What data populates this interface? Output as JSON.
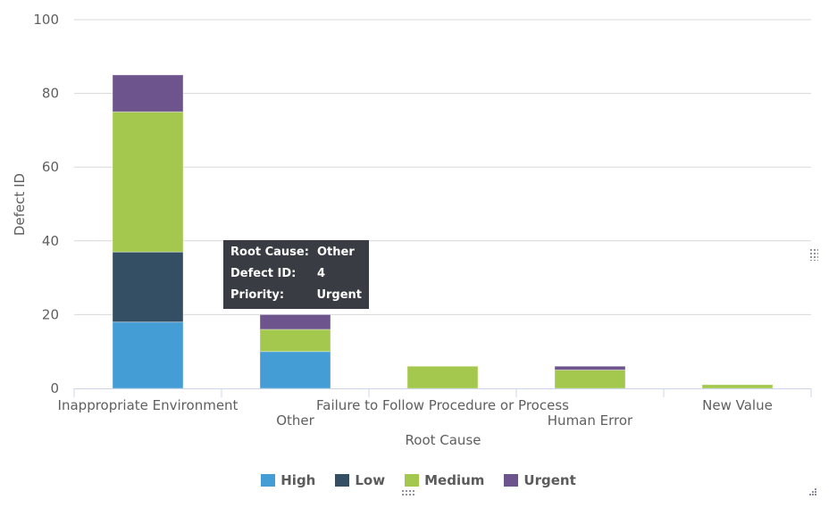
{
  "chart_data": {
    "type": "bar",
    "stacked": true,
    "title": "",
    "xlabel": "Root Cause",
    "ylabel": "Defect ID",
    "ylim": [
      0,
      100
    ],
    "yticks": [
      0,
      20,
      40,
      60,
      80,
      100
    ],
    "grid": true,
    "categories": [
      "Inappropriate Environment",
      "Other",
      "Failure to Follow Procedure or Process",
      "Human Error",
      "New Value"
    ],
    "series": [
      {
        "name": "High",
        "color": "#449dd5",
        "values": [
          18,
          10,
          0,
          0,
          0
        ]
      },
      {
        "name": "Low",
        "color": "#344e64",
        "values": [
          19,
          0,
          0,
          0,
          0
        ]
      },
      {
        "name": "Medium",
        "color": "#a3c84d",
        "values": [
          38,
          6,
          6,
          5,
          1
        ]
      },
      {
        "name": "Urgent",
        "color": "#6e548d",
        "values": [
          10,
          4,
          0,
          1,
          0
        ]
      }
    ],
    "legend": {
      "placement": "bottom-center",
      "items": [
        "High",
        "Low",
        "Medium",
        "Urgent"
      ]
    }
  },
  "tooltip": {
    "rows": [
      {
        "key": "Root Cause:",
        "value": "Other"
      },
      {
        "key": "Defect ID:",
        "value": "4"
      },
      {
        "key": "Priority:",
        "value": "Urgent"
      }
    ]
  }
}
